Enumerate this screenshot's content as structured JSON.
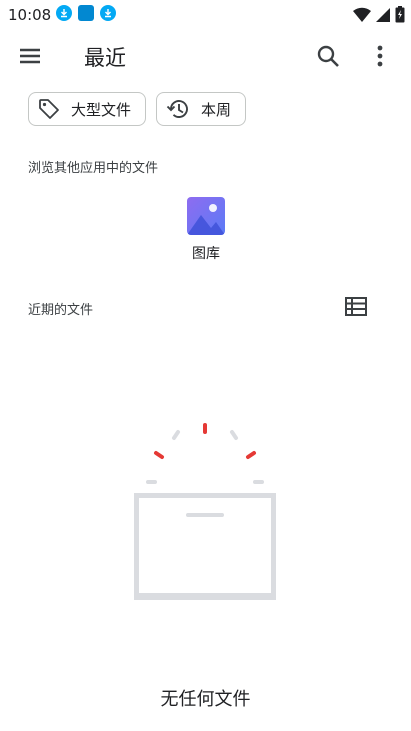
{
  "status_bar": {
    "time": "10:08",
    "icons": [
      "download-icon",
      "app-notification-icon",
      "download-icon",
      "wifi-icon",
      "signal-icon",
      "battery-icon"
    ]
  },
  "toolbar": {
    "title": "最近",
    "menu_icon": "menu-icon",
    "search_icon": "search-icon",
    "more_icon": "more-vert-icon"
  },
  "filters": [
    {
      "label": "大型文件",
      "icon": "tag-icon"
    },
    {
      "label": "本周",
      "icon": "history-icon"
    }
  ],
  "browse_section": {
    "title": "浏览其他应用中的文件",
    "apps": [
      {
        "label": "图库",
        "icon": "gallery-icon"
      }
    ]
  },
  "recent_section": {
    "title": "近期的文件",
    "view_icon": "list-view-icon"
  },
  "empty_state": {
    "text": "无任何文件"
  },
  "colors": {
    "accent_purple": "#7b5cf0",
    "accent_blue": "#4f7bf7",
    "loader_red": "#e53935",
    "loader_gray": "#dadce0",
    "chip_border": "#c4c7c5"
  }
}
